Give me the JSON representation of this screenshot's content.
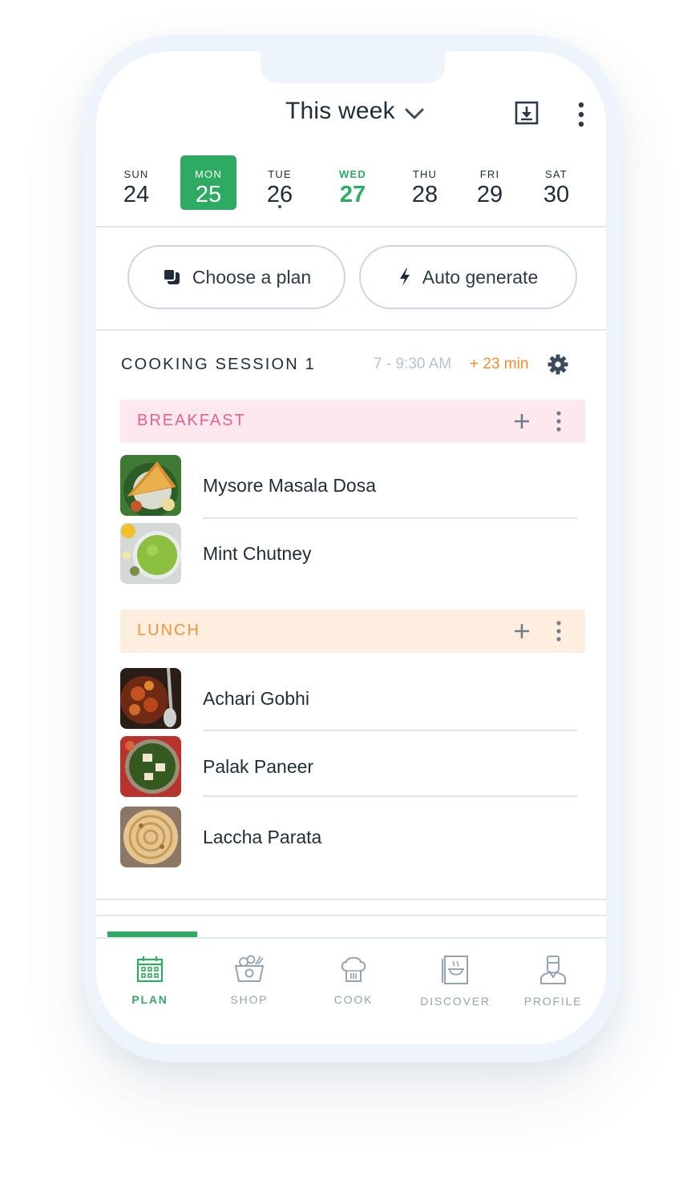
{
  "header": {
    "title": "This week",
    "chevron_icon": "chevron-down-icon",
    "download_icon": "download-icon",
    "more_icon": "more-vertical-icon"
  },
  "days": [
    {
      "name": "SUN",
      "num": "24",
      "state": "normal"
    },
    {
      "name": "MON",
      "num": "25",
      "state": "selected"
    },
    {
      "name": "TUE",
      "num": "26",
      "state": "dot"
    },
    {
      "name": "WED",
      "num": "27",
      "state": "today"
    },
    {
      "name": "THU",
      "num": "28",
      "state": "normal"
    },
    {
      "name": "FRI",
      "num": "29",
      "state": "normal"
    },
    {
      "name": "SAT",
      "num": "30",
      "state": "normal"
    }
  ],
  "actions": {
    "choose_plan": "Choose a plan",
    "auto_generate": "Auto generate"
  },
  "session": {
    "title": "COOKING SESSION 1",
    "time": "7 - 9:30 AM",
    "extra": "+ 23 min"
  },
  "meals": {
    "breakfast": {
      "label": "BREAKFAST",
      "items": [
        "Mysore Masala Dosa",
        "Mint Chutney"
      ]
    },
    "lunch": {
      "label": "LUNCH",
      "items": [
        "Achari Gobhi",
        "Palak Paneer",
        "Laccha Parata"
      ]
    }
  },
  "tabs": [
    {
      "label": "PLAN",
      "icon": "calendar-icon",
      "active": true
    },
    {
      "label": "SHOP",
      "icon": "basket-icon",
      "active": false
    },
    {
      "label": "COOK",
      "icon": "chef-hat-icon",
      "active": false
    },
    {
      "label": "DISCOVER",
      "icon": "recipe-book-icon",
      "active": false
    },
    {
      "label": "PROFILE",
      "icon": "profile-icon",
      "active": false
    }
  ],
  "colors": {
    "accent_green": "#2eab62",
    "breakfast_bg": "#fde8ef",
    "breakfast_text": "#e8608b",
    "lunch_bg": "#fdeedf",
    "lunch_text": "#f0943c",
    "extra_time": "#f08a2d"
  }
}
